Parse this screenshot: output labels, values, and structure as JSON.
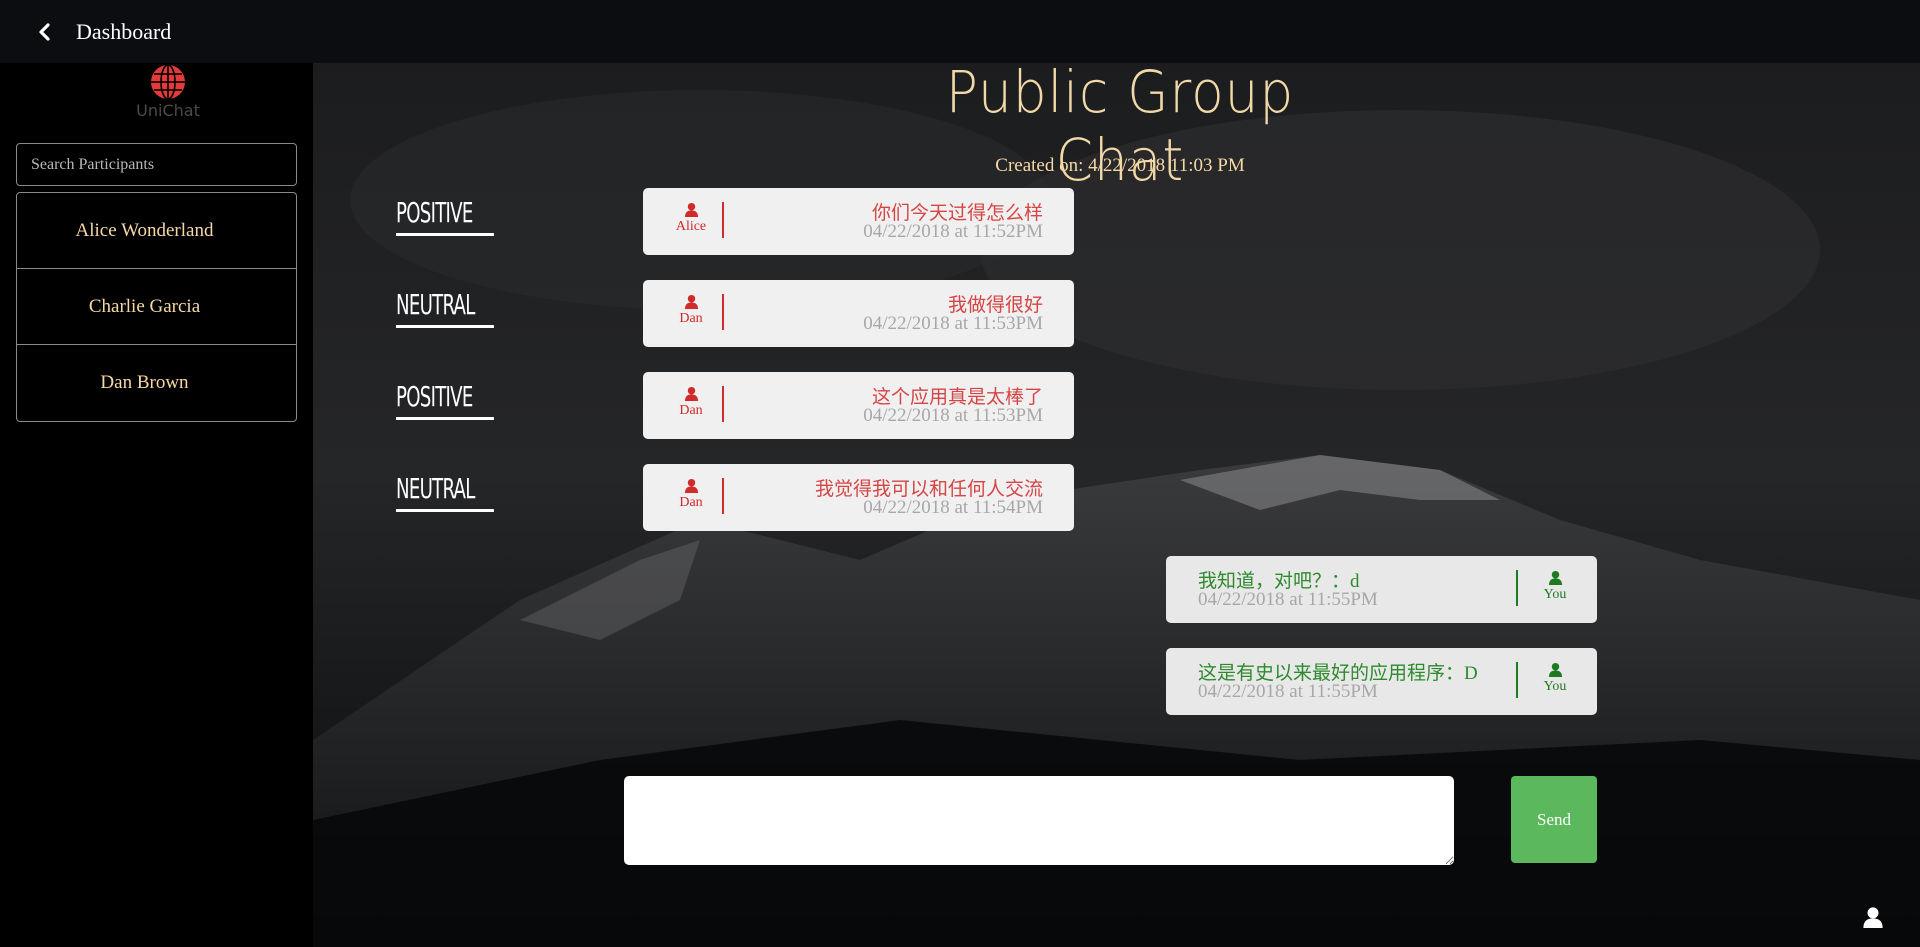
{
  "header": {
    "back_label": "Dashboard"
  },
  "sidebar": {
    "logo_text": "UniChat",
    "search_placeholder": "Search Participants",
    "participants": [
      "Alice Wonderland",
      "Charlie Garcia",
      "Dan Brown"
    ]
  },
  "chat": {
    "title": "Public Group Chat",
    "created": "Created on: 4/22/2018 11:03 PM",
    "sentiments": [
      "POSITIVE",
      "NEUTRAL",
      "POSITIVE",
      "NEUTRAL"
    ],
    "messages": [
      {
        "sender": "Alice",
        "text": "你们今天过得怎么样",
        "time": "04/22/2018 at 11:52PM"
      },
      {
        "sender": "Dan",
        "text": "我做得很好",
        "time": "04/22/2018 at 11:53PM"
      },
      {
        "sender": "Dan",
        "text": "这个应用真是太棒了",
        "time": "04/22/2018 at 11:53PM"
      },
      {
        "sender": "Dan",
        "text": "我觉得我可以和任何人交流",
        "time": "04/22/2018 at 11:54PM"
      },
      {
        "sender": "You",
        "text": "我知道，对吧？：d",
        "time": "04/22/2018 at 11:55PM"
      },
      {
        "sender": "You",
        "text": "这是有史以来最好的应用程序：D",
        "time": "04/22/2018 at 11:55PM"
      }
    ],
    "input_value": "",
    "send_label": "Send"
  },
  "colors": {
    "accent_gold": "#f7d9a6",
    "other_user": "#d12a2a",
    "self_user": "#1e7a1e",
    "send_button": "#5cb85c"
  },
  "icons": [
    "back-chevron-icon",
    "globe-icon",
    "user-icon"
  ]
}
